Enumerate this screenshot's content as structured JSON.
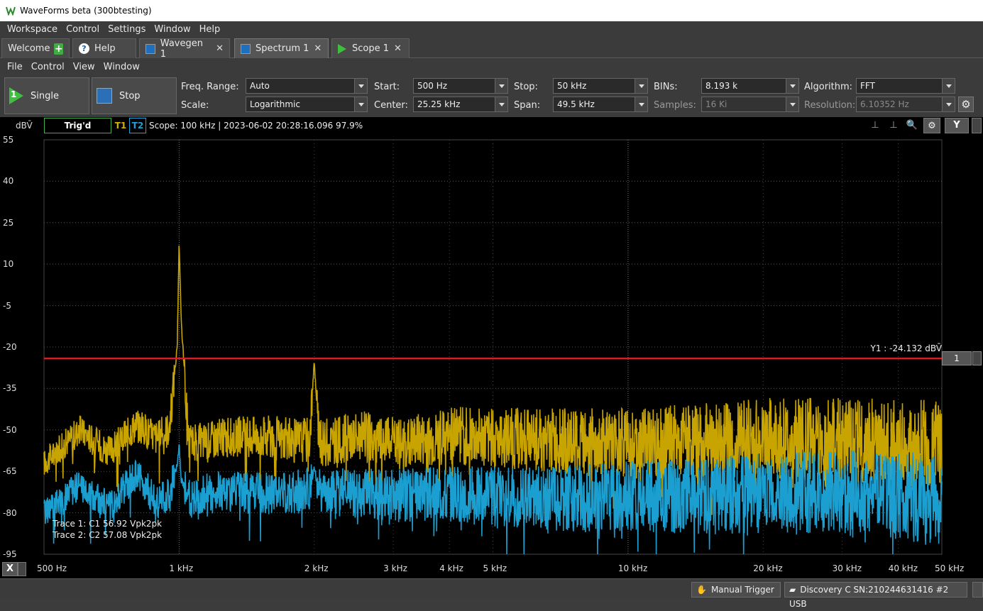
{
  "window": {
    "title": "WaveForms beta (300btesting)"
  },
  "menu": [
    "Workspace",
    "Control",
    "Settings",
    "Window",
    "Help"
  ],
  "tabs": [
    {
      "label": "Welcome",
      "icon": "plus-icon"
    },
    {
      "label": "Help",
      "icon": "help-icon"
    },
    {
      "label": "Wavegen 1",
      "icon": "wavegen-icon"
    },
    {
      "label": "Spectrum 1",
      "icon": "spectrum-icon",
      "active": true
    },
    {
      "label": "Scope 1",
      "icon": "scope-icon"
    }
  ],
  "submenu": [
    "File",
    "Control",
    "View",
    "Window"
  ],
  "toolbar": {
    "single_label": "Single",
    "single_number": "1",
    "stop_label": "Stop",
    "freq_range_label": "Freq. Range:",
    "freq_range_value": "Auto",
    "scale_label": "Scale:",
    "scale_value": "Logarithmic",
    "start_label": "Start:",
    "start_value": "500 Hz",
    "center_label": "Center:",
    "center_value": "25.25 kHz",
    "stop_freq_label": "Stop:",
    "stop_freq_value": "50 kHz",
    "span_label": "Span:",
    "span_value": "49.5 kHz",
    "bins_label": "BINs:",
    "bins_value": "8.193 k",
    "samples_label": "Samples:",
    "samples_value": "16 Ki",
    "algorithm_label": "Algorithm:",
    "algorithm_value": "FFT",
    "resolution_label": "Resolution:",
    "resolution_value": "6.10352 Hz"
  },
  "plot": {
    "y_unit": "dBV̄",
    "trig_status": "Trig'd",
    "trace1_label": "T1",
    "trace2_label": "T2",
    "scope_info": "Scope: 100 kHz | 2023-06-02 20:28:16.096 97.9%",
    "y_button": "Y",
    "x_button": "X",
    "marker_label": "Y1 : -24.132 dBV̄",
    "marker_button": "1",
    "trace1_info": "Trace 1: C1 56.92 Vpk2pk",
    "trace2_info": "Trace 2: C2 57.08 Vpk2pk"
  },
  "chart_data": {
    "type": "line",
    "xlabel": "",
    "ylabel": "dBV̄",
    "x_scale": "log",
    "xlim": [
      500,
      50000
    ],
    "ylim": [
      -95,
      55
    ],
    "y_ticks": [
      "55",
      "40",
      "25",
      "10",
      "-5",
      "-20",
      "-35",
      "-50",
      "-65",
      "-80",
      "-95"
    ],
    "x_ticks": [
      "500 Hz",
      "1 kHz",
      "2 kHz",
      "3 kHz",
      "4 kHz",
      "5 kHz",
      "10 kHz",
      "20 kHz",
      "30 kHz",
      "40 kHz",
      "50 kHz"
    ],
    "x_tick_values": [
      500,
      1000,
      2000,
      3000,
      4000,
      5000,
      10000,
      20000,
      30000,
      40000,
      50000
    ],
    "marker_y": -24.132,
    "series": [
      {
        "name": "Trace 1",
        "color": "#c8a400",
        "x": [
          500,
          600,
          700,
          800,
          900,
          950,
          990,
          1000,
          1010,
          1050,
          1200,
          1500,
          1800,
          1950,
          2000,
          2050,
          2500,
          3000,
          4000,
          5000,
          7000,
          10000,
          15000,
          20000,
          30000,
          40000,
          50000
        ],
        "y": [
          -62,
          -50,
          -58,
          -48,
          -53,
          -49,
          -20,
          18,
          -10,
          -55,
          -53,
          -52,
          -54,
          -53,
          -25,
          -55,
          -52,
          -55,
          -52,
          -53,
          -54,
          -55,
          -54,
          -53,
          -54,
          -55,
          -56
        ]
      },
      {
        "name": "Trace 2",
        "color": "#1b9ed0",
        "x": [
          500,
          600,
          700,
          800,
          900,
          950,
          990,
          1000,
          1010,
          1050,
          1200,
          1500,
          1800,
          1950,
          2000,
          2050,
          2500,
          3000,
          4000,
          5000,
          7000,
          10000,
          15000,
          20000,
          30000,
          40000,
          50000
        ],
        "y": [
          -80,
          -70,
          -78,
          -66,
          -76,
          -74,
          -62,
          -55,
          -68,
          -75,
          -72,
          -73,
          -72,
          -72,
          -64,
          -72,
          -73,
          -74,
          -73,
          -74,
          -75,
          -74,
          -74,
          -73,
          -73,
          -74,
          -76
        ]
      }
    ]
  },
  "status": {
    "manual_trigger": "Manual Trigger",
    "device": "Discovery C SN:210244631416 #2 USB"
  },
  "colors": {
    "trace1": "#c8a400",
    "trace2": "#1b9ed0",
    "marker": "#d0202a",
    "trig_border": "#3fae49"
  }
}
